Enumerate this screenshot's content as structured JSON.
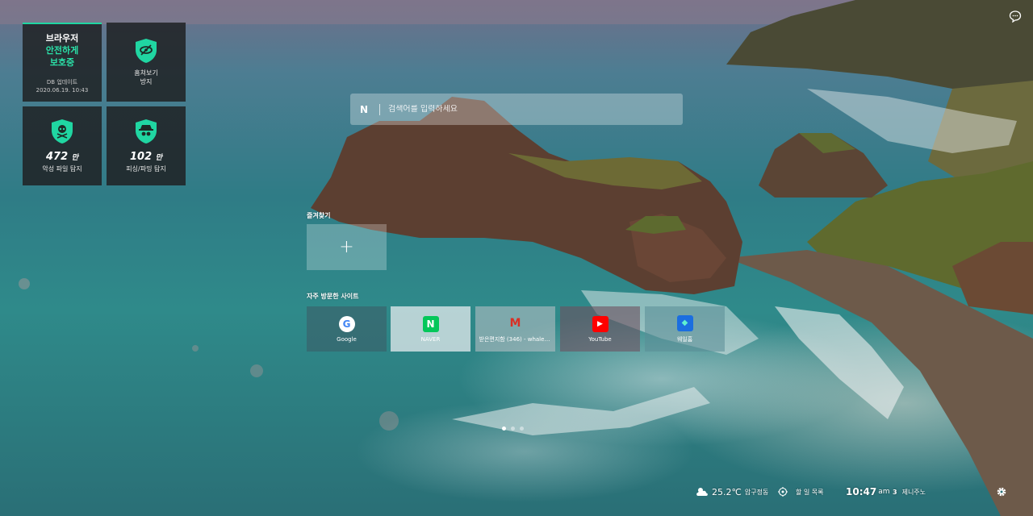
{
  "widgets": {
    "security": {
      "title": "브라우저",
      "status_line1": "안전하게",
      "status_line2": "보호중",
      "update_label": "DB 업데이트",
      "update_time": "2020.06.19. 10:43"
    },
    "peek": {
      "label_line1": "훔쳐보기",
      "label_line2": "방지"
    },
    "malware": {
      "count": "472",
      "unit": "만",
      "label": "악성 파일 탐지"
    },
    "phishing": {
      "count": "102",
      "unit": "만",
      "label": "피싱/파밍 탐지"
    },
    "accent_color": "#20d6a2"
  },
  "search": {
    "logo": "N",
    "placeholder": "검색어를 입력하세요"
  },
  "favorites": {
    "label": "즐겨찾기",
    "add_symbol": "+"
  },
  "frequent": {
    "label": "자주 방문한 사이트",
    "sites": [
      {
        "name": "Google",
        "icon": "google-icon",
        "glyph": "G"
      },
      {
        "name": "NAVER",
        "icon": "naver-icon",
        "glyph": "N"
      },
      {
        "name": "받은편지함 (346) - whalet...",
        "icon": "gmail-icon",
        "glyph": "M"
      },
      {
        "name": "YouTube",
        "icon": "youtube-icon",
        "glyph": "▶"
      },
      {
        "name": "웨일홈",
        "icon": "whale-icon",
        "glyph": "◆"
      }
    ]
  },
  "bottom_bar": {
    "weather": {
      "temp": "25.2℃",
      "location": "압구정동",
      "icon": "cloud-icon"
    },
    "todo": {
      "label": "할 일 목록",
      "icon": "target-icon"
    },
    "clock": {
      "time": "10:47",
      "ampm": "am"
    },
    "news": {
      "rank": "3",
      "headline": "제니주노"
    }
  }
}
